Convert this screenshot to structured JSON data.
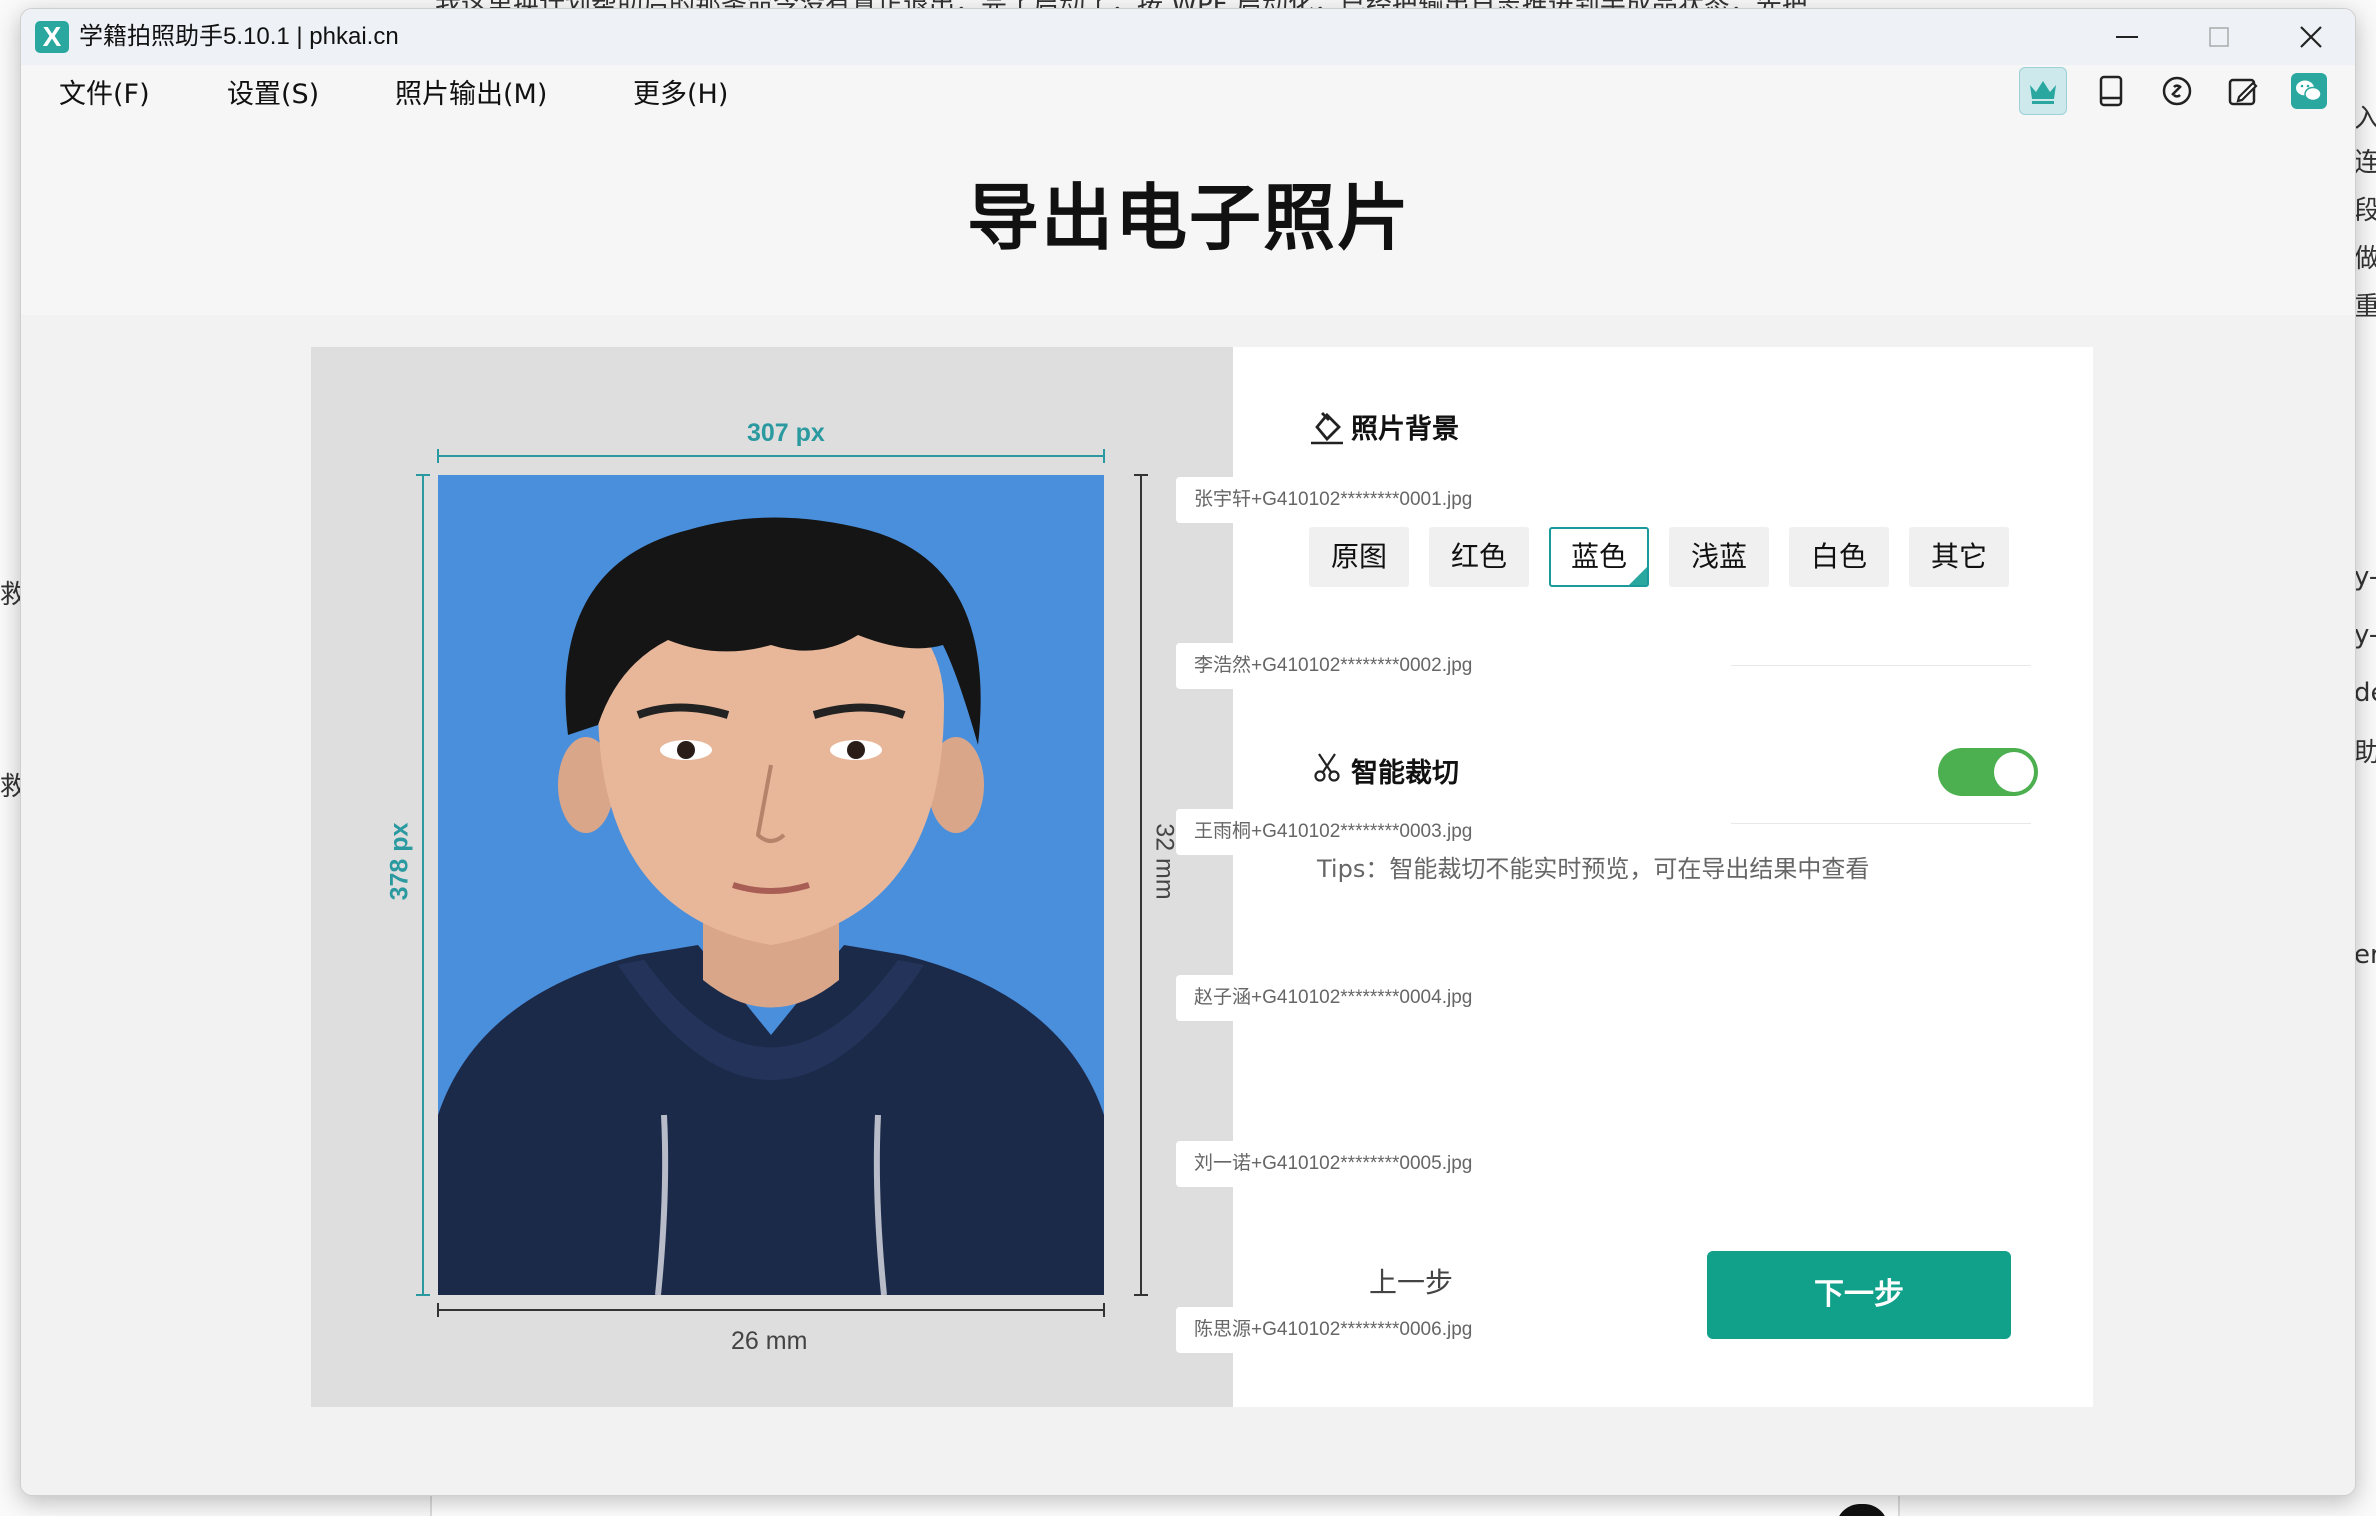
{
  "background": {
    "top_text": "我这里换计划帮助后的那条命令没有真正退出，完了启动了，按 WPF 启动化，已经把输出日志推进到半成品状态，先把",
    "right_edge_lines": [
      "入",
      "连",
      "段约",
      "做",
      "重",
      "y-",
      "y-",
      "de",
      "助",
      "er"
    ],
    "left_edge_lines": [
      "救",
      "救"
    ]
  },
  "window": {
    "title": "学籍拍照助手5.10.1 | phkai.cn",
    "logo_letter": "X"
  },
  "menu": {
    "file": "文件(F)",
    "settings": "设置(S)",
    "output": "照片输出(M)",
    "more": "更多(H)"
  },
  "page": {
    "title": "导出电子照片"
  },
  "preview": {
    "width_px": "307 px",
    "height_px": "378 px",
    "width_mm": "26 mm",
    "height_mm": "32 mm"
  },
  "settings": {
    "background_title": "照片背景",
    "background_options": [
      "原图",
      "红色",
      "蓝色",
      "浅蓝",
      "白色",
      "其它"
    ],
    "selected_background": "蓝色",
    "crop_title": "智能裁切",
    "crop_enabled": true,
    "tips": "Tips：智能裁切不能实时预览，可在导出结果中查看",
    "prev_label": "上一步",
    "next_label": "下一步"
  },
  "files": [
    "张宇轩+G410102********0001.jpg",
    "李浩然+G410102********0002.jpg",
    "王雨桐+G410102********0003.jpg",
    "赵子涵+G410102********0004.jpg",
    "刘一诺+G410102********0005.jpg",
    "陈思源+G410102********0006.jpg"
  ],
  "colors": {
    "accent": "#11a18b",
    "dimension": "#2a9aa0",
    "photo_background": "#4a8fdc",
    "toggle_on": "#4caf50"
  }
}
